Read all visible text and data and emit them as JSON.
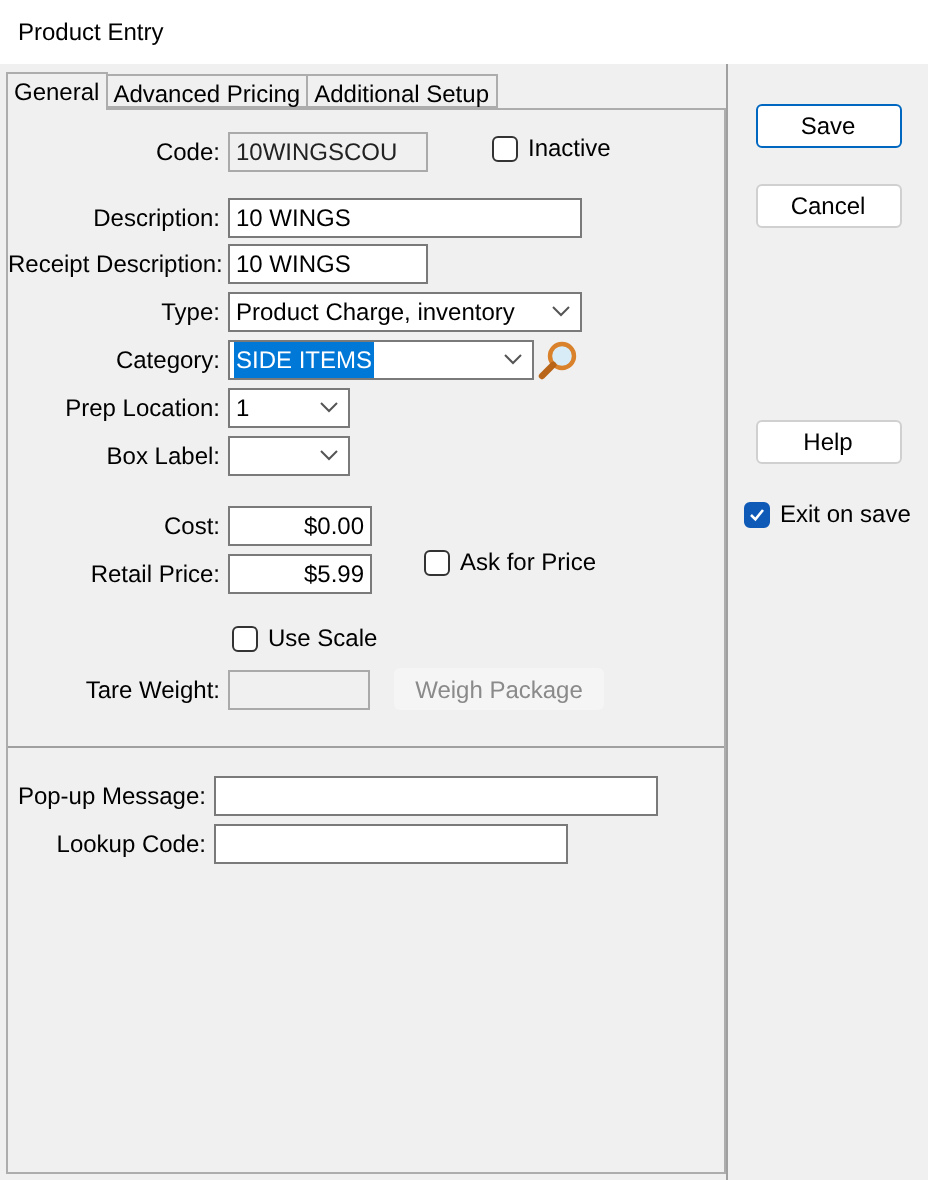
{
  "window": {
    "title": "Product Entry"
  },
  "tabs": [
    {
      "label": "General",
      "selected": true
    },
    {
      "label": "Advanced Pricing",
      "selected": false
    },
    {
      "label": "Additional Setup",
      "selected": false
    }
  ],
  "general": {
    "code": {
      "label": "Code:",
      "value": "10WINGSCOU",
      "disabled": true
    },
    "inactive": {
      "label": "Inactive",
      "checked": false
    },
    "description": {
      "label": "Description:",
      "value": "10 WINGS"
    },
    "receipt_description": {
      "label": "Receipt Description:",
      "value": "10 WINGS"
    },
    "type": {
      "label": "Type:",
      "value": "Product Charge, inventory"
    },
    "category": {
      "label": "Category:",
      "value": "SIDE ITEMS",
      "highlighted": true
    },
    "prep_location": {
      "label": "Prep Location:",
      "value": "1"
    },
    "box_label": {
      "label": "Box Label:"
    },
    "cost": {
      "label": "Cost:",
      "value": "$0.00"
    },
    "retail_price": {
      "label": "Retail Price:",
      "value": "$5.99"
    },
    "ask_for_price": {
      "label": "Ask for Price",
      "checked": false
    },
    "use_scale": {
      "label": "Use Scale",
      "checked": false
    },
    "tare_weight": {
      "label": "Tare Weight:",
      "disabled": true
    },
    "weigh_package": {
      "label": "Weigh Package",
      "disabled": true
    },
    "popup_message": {
      "label": "Pop-up Message:"
    },
    "lookup_code": {
      "label": "Lookup Code:"
    }
  },
  "buttons": [
    {
      "label": "Save",
      "default": true
    },
    {
      "label": "Cancel",
      "default": false
    }
  ],
  "help": {
    "label": "Help"
  },
  "exit_on_save": {
    "label": "Exit on save",
    "checked": true
  }
}
